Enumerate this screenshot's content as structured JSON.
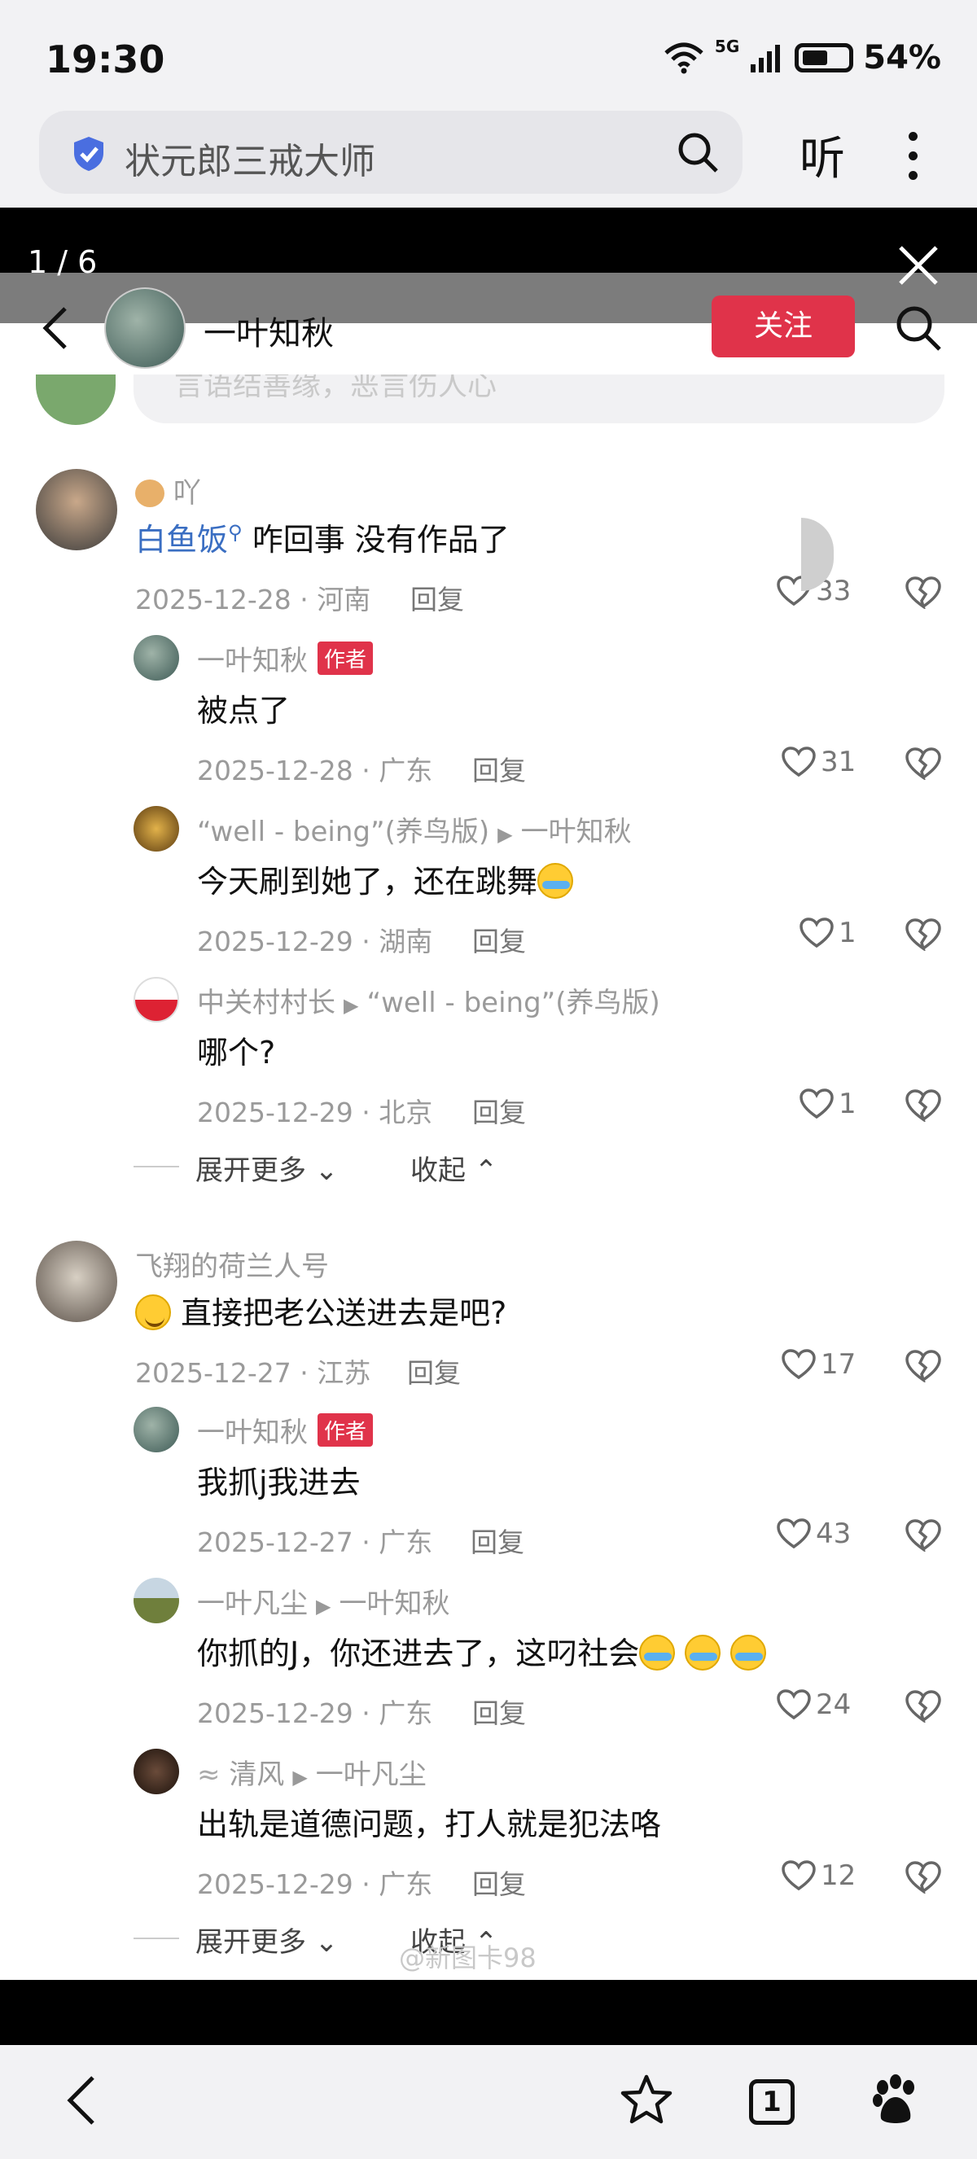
{
  "status_bar": {
    "time": "19:30",
    "network": "5G",
    "battery": "54%"
  },
  "browser": {
    "search_query": "状元郎三戒大师",
    "listen_label": "听"
  },
  "viewer": {
    "counter": "1 / 6"
  },
  "header": {
    "username": "一叶知秋",
    "follow_label": "关注"
  },
  "input_placeholder": "言语结善缘，恶言伤人心",
  "author_tag": "作者",
  "threads": [
    {
      "user": "吖",
      "mention": "白鱼饭",
      "text": "咋回事 没有作品了",
      "date": "2025-12-28 · 河南",
      "reply": "回复",
      "likes": "33",
      "replies": [
        {
          "user": "一叶知秋",
          "text": "被点了",
          "date": "2025-12-28 · 广东",
          "reply": "回复",
          "likes": "31"
        },
        {
          "user": "“well - being”(养鸟版)",
          "to": "一叶知秋",
          "text": "今天刷到她了，还在跳舞",
          "date": "2025-12-29 · 湖南",
          "reply": "回复",
          "likes": "1"
        },
        {
          "user": "中关村村长",
          "to": "“well - being”(养鸟版)",
          "text": "哪个?",
          "date": "2025-12-29 · 北京",
          "reply": "回复",
          "likes": "1"
        }
      ],
      "expand": "展开更多",
      "collapse": "收起"
    },
    {
      "user": "飞翔的荷兰人号",
      "text": "直接把老公送进去是吧?",
      "date": "2025-12-27 · 江苏",
      "reply": "回复",
      "likes": "17",
      "replies": [
        {
          "user": "一叶知秋",
          "text": "我抓j我进去",
          "date": "2025-12-27 · 广东",
          "reply": "回复",
          "likes": "43"
        },
        {
          "user": "一叶凡尘",
          "to": "一叶知秋",
          "text": "你抓的J，你还进去了，这叼社会",
          "date": "2025-12-29 · 广东",
          "reply": "回复",
          "likes": "24"
        },
        {
          "user": "清风",
          "to": "一叶凡尘",
          "text": "出轨是道德问题，打人就是犯法咯",
          "date": "2025-12-29 · 广东",
          "reply": "回复",
          "likes": "12"
        }
      ],
      "expand": "展开更多",
      "collapse": "收起"
    }
  ],
  "watermark": "@新图卡98",
  "nav": {
    "tab_count": "1"
  }
}
